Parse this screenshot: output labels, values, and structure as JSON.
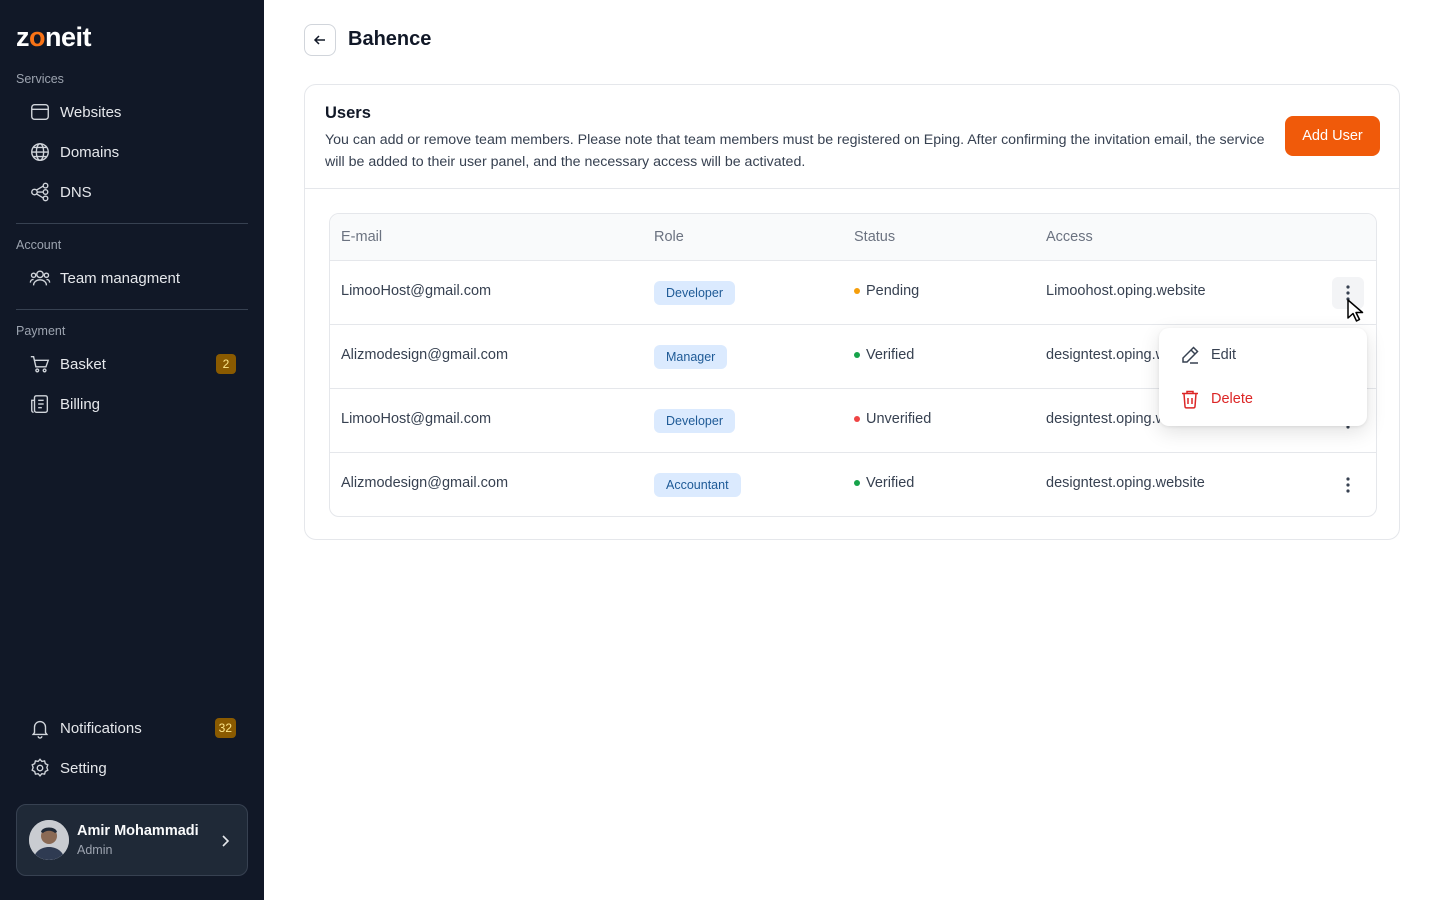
{
  "app": {
    "logo_prefix": "z",
    "logo_accent": "o",
    "logo_suffix": "neit",
    "brand_color": "#f05a0a"
  },
  "sidebar": {
    "services_label": "Services",
    "account_label": "Account",
    "payment_label": "Payment",
    "items": [
      {
        "label": "Websites",
        "icon": "browser-icon"
      },
      {
        "label": "Domains",
        "icon": "globe-icon"
      },
      {
        "label": "DNS",
        "icon": "dns-icon"
      },
      {
        "label": "Team managment",
        "icon": "team-icon"
      },
      {
        "label": "Basket",
        "icon": "cart-icon",
        "badge": "2"
      },
      {
        "label": "Billing",
        "icon": "billing-icon"
      },
      {
        "label": "Notifications",
        "icon": "bell-icon",
        "badge": "32"
      },
      {
        "label": "Setting",
        "icon": "gear-icon"
      }
    ],
    "profile": {
      "name": "Amir Mohammadi",
      "role": "Admin"
    }
  },
  "header": {
    "title": "Bahence"
  },
  "users_card": {
    "title": "Users",
    "description": "You can add or remove team members. Please note that team members must be registered on Eping. After confirming the invitation email, the service will be added to their user panel, and the necessary access will be activated.",
    "add_button": "Add User"
  },
  "table": {
    "headers": [
      "E-mail",
      "Role",
      "Status",
      "Access"
    ],
    "rows": [
      {
        "email": "LimooHost@gmail.com",
        "role": "Developer",
        "status": "Pending",
        "status_color": "#f59e0b",
        "access": "Limoohost.oping.website"
      },
      {
        "email": "Alizmodesign@gmail.com",
        "role": "Manager",
        "status": "Verified",
        "status_color": "#16a34a",
        "access": "designtest.oping.website"
      },
      {
        "email": "LimooHost@gmail.com",
        "role": "Developer",
        "status": "Unverified",
        "status_color": "#ef4444",
        "access": "designtest.oping.website"
      },
      {
        "email": "Alizmodesign@gmail.com",
        "role": "Accountant",
        "status": "Verified",
        "status_color": "#16a34a",
        "access": "designtest.oping.website"
      }
    ]
  },
  "menu": {
    "edit_label": "Edit",
    "delete_label": "Delete",
    "delete_color": "#dc2626"
  }
}
